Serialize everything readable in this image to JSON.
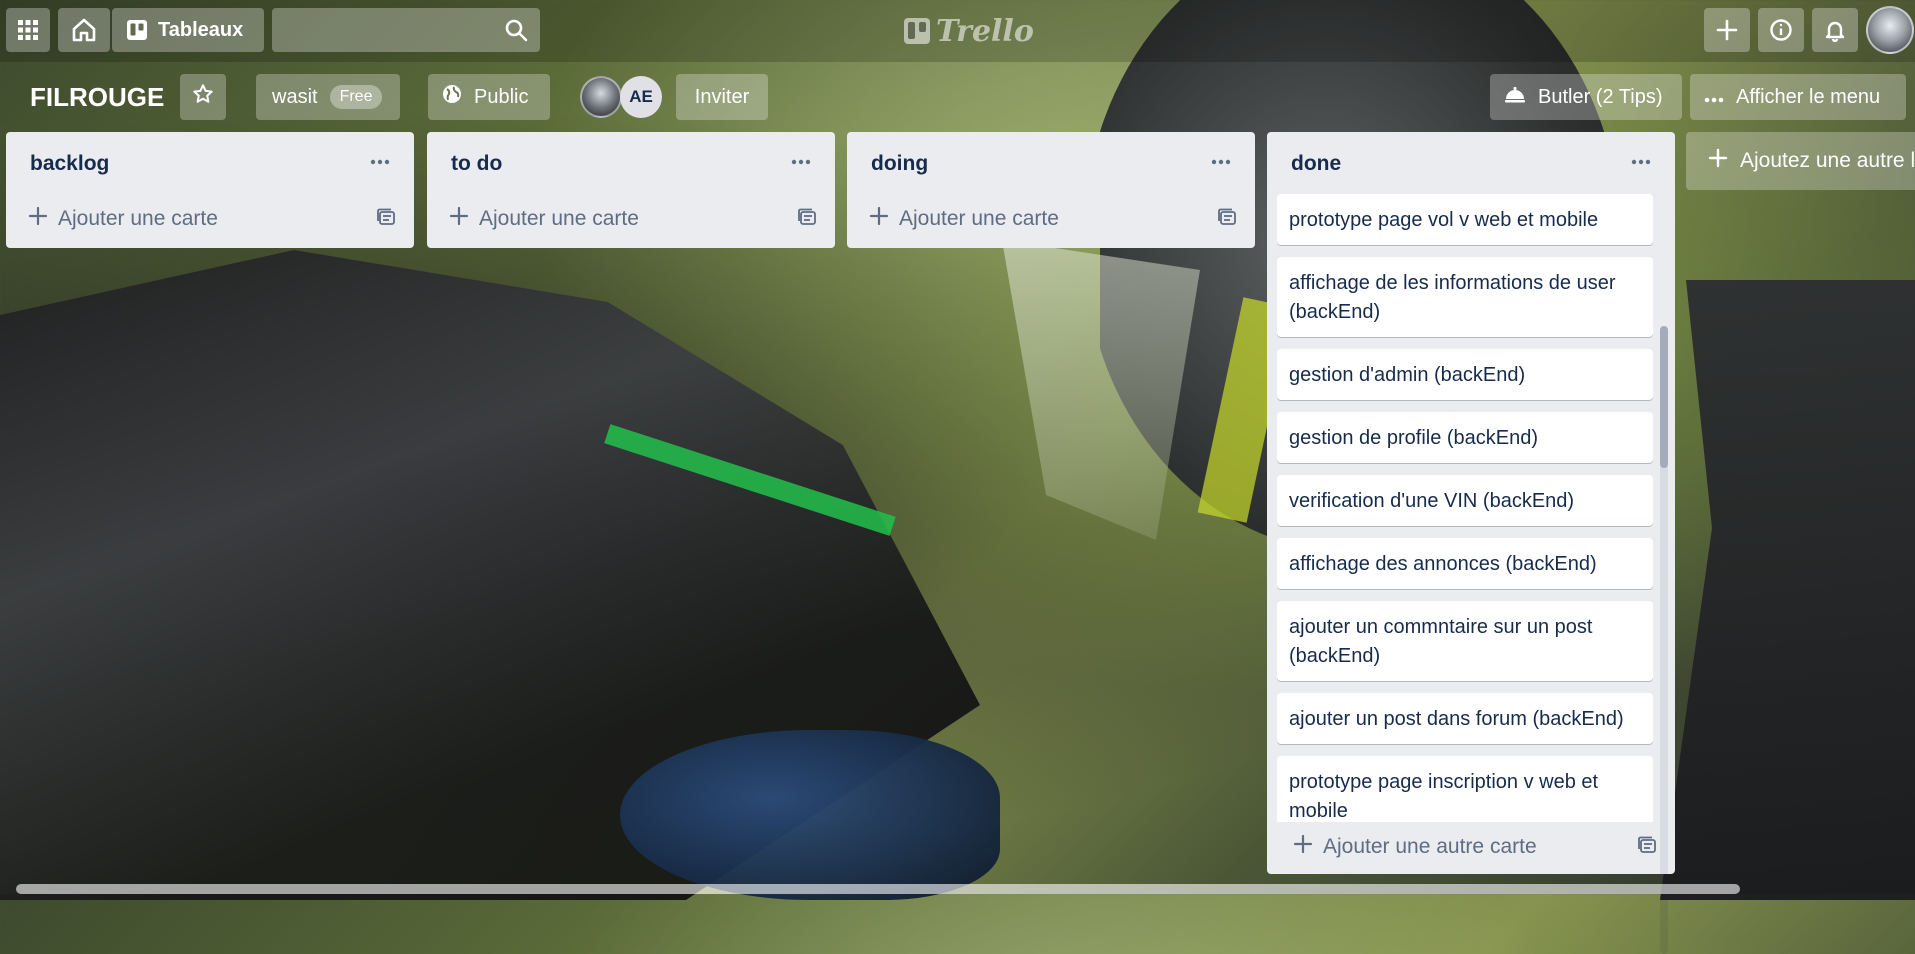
{
  "topbar": {
    "boards_label": "Tableaux",
    "search_placeholder": "",
    "logo_text": "Trello",
    "icons": [
      "apps-grid-icon",
      "home-icon",
      "boards-icon",
      "search-icon",
      "plus-icon",
      "info-icon",
      "bell-icon"
    ]
  },
  "board": {
    "title": "FILROUGE",
    "team_name": "wasit",
    "team_badge": "Free",
    "visibility": "Public",
    "member_initials": "AE",
    "invite_label": "Inviter",
    "butler_label": "Butler (2 Tips)",
    "menu_label": "Afficher le menu"
  },
  "lists": [
    {
      "title": "backlog",
      "add_label": "Ajouter une carte",
      "cards": []
    },
    {
      "title": "to do",
      "add_label": "Ajouter une carte",
      "cards": []
    },
    {
      "title": "doing",
      "add_label": "Ajouter une carte",
      "cards": []
    },
    {
      "title": "done",
      "add_label": "Ajouter une autre carte",
      "cards": [
        "prototype page vol v web et mobile",
        "affichage de les informations de user (backEnd)",
        "gestion d'admin (backEnd)",
        "gestion de profile (backEnd)",
        "verification d'une VIN (backEnd)",
        "affichage des annonces (backEnd)",
        "ajouter un commntaire sur un post (backEnd)",
        "ajouter un post dans forum (backEnd)",
        "prototype page inscription v web et mobile"
      ]
    }
  ],
  "add_list_label": "Ajoutez une autre liste"
}
